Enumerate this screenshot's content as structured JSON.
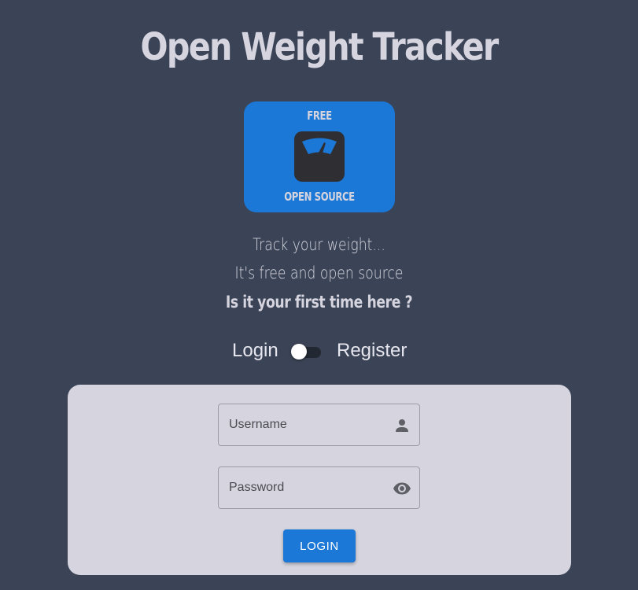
{
  "app": {
    "title": "Open Weight Tracker"
  },
  "logo": {
    "top_text": "FREE",
    "bottom_text": "OPEN SOURCE",
    "icon": "scale-icon",
    "color": "#1c78d6"
  },
  "tagline": {
    "line1": "Track your weight...",
    "line2": "It's free and open source",
    "line3": "Is it your first time here ?"
  },
  "mode_switch": {
    "left_label": "Login",
    "right_label": "Register",
    "checked": false
  },
  "form": {
    "username": {
      "placeholder": "Username",
      "value": "",
      "icon": "user-icon"
    },
    "password": {
      "placeholder": "Password",
      "value": "",
      "icon": "eye-icon"
    },
    "submit_label": "LOGIN"
  },
  "colors": {
    "background": "#3a4456",
    "accent": "#1c78d6",
    "card": "#d6d5df"
  }
}
